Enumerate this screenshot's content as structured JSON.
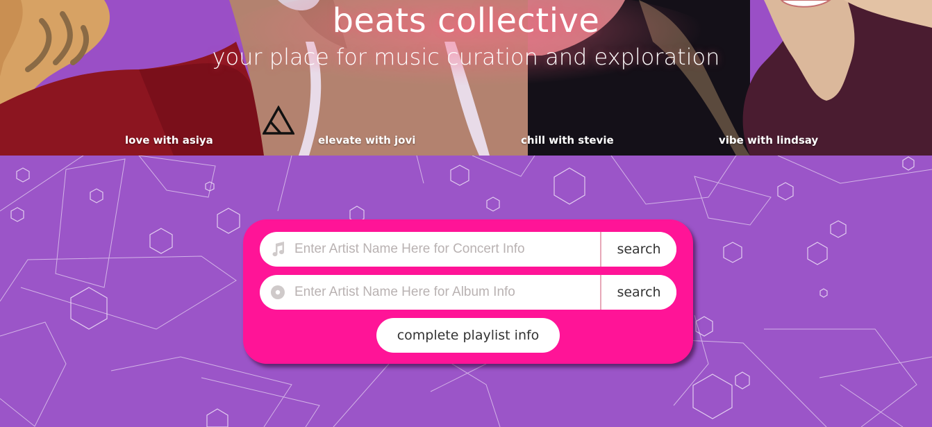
{
  "hero": {
    "title": "beats collective",
    "subtitle": "your place for music curation and exploration",
    "personas": [
      "love with asiya",
      "elevate with jovi",
      "chill with stevie",
      "vibe with lindsay"
    ]
  },
  "search": {
    "concert": {
      "placeholder": "Enter Artist Name Here for Concert Info",
      "button": "search",
      "icon": "music-note-icon"
    },
    "album": {
      "placeholder": "Enter Artist Name Here for Album Info",
      "button": "search",
      "icon": "disc-icon"
    },
    "playlist_button": "complete playlist info"
  },
  "colors": {
    "background": "#9b55c8",
    "panel": "#ff1497",
    "text": "#333333"
  }
}
